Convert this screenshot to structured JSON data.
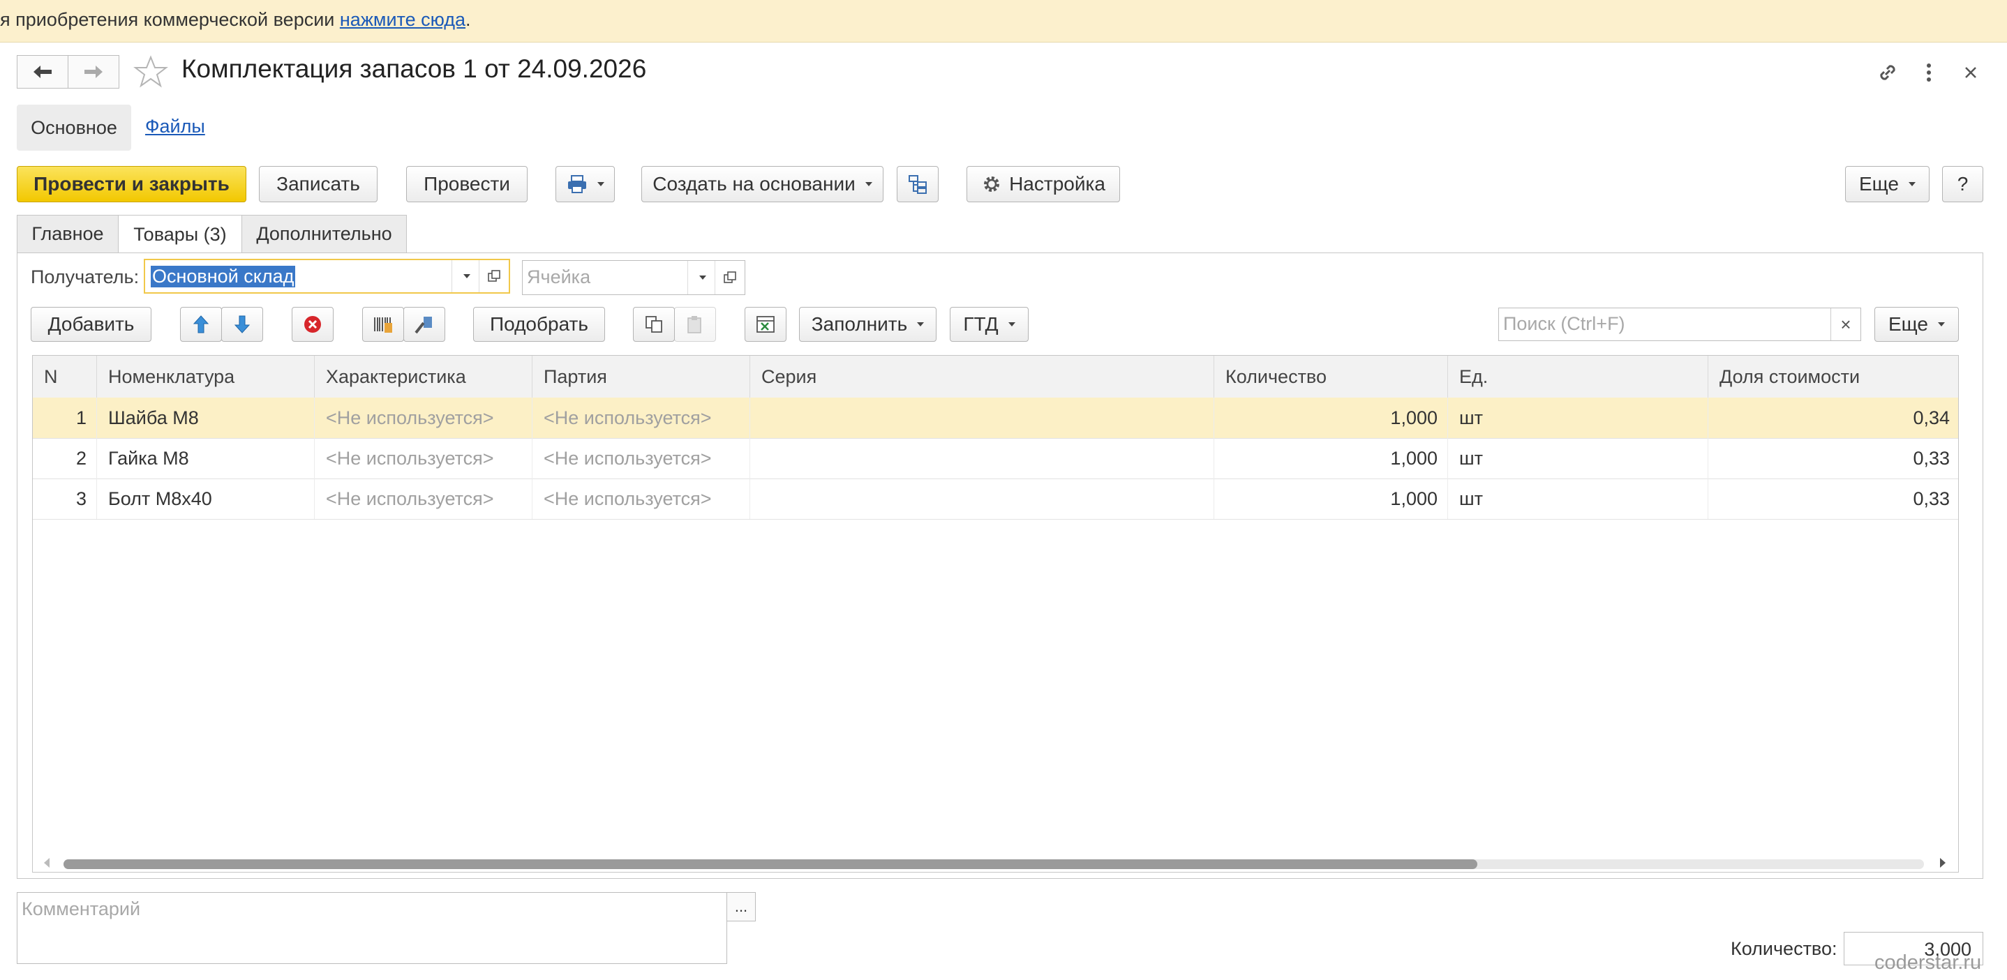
{
  "banner": {
    "text": "я приобретения коммерческой версии ",
    "link": "нажмите сюда",
    "after": "."
  },
  "header": {
    "title": "Комплектация запасов 1 от 24.09.2026"
  },
  "section_tabs": {
    "main": "Основное",
    "files": "Файлы"
  },
  "toolbar": {
    "post_close": "Провести и закрыть",
    "save": "Записать",
    "post": "Провести",
    "create_based": "Создать на основании",
    "settings": "Настройка",
    "more": "Еще",
    "help": "?"
  },
  "tabs": [
    "Главное",
    "Товары (3)",
    "Дополнительно"
  ],
  "recipient": {
    "label": "Получатель:",
    "value": "Основной склад",
    "cell_placeholder": "Ячейка"
  },
  "table_toolbar": {
    "add": "Добавить",
    "pick": "Подобрать",
    "fill": "Заполнить",
    "gtd": "ГТД",
    "search_placeholder": "Поиск (Ctrl+F)",
    "clear": "×",
    "more": "Еще"
  },
  "table": {
    "columns": [
      "N",
      "Номенклатура",
      "Характеристика",
      "Партия",
      "Серия",
      "Количество",
      "Ед.",
      "Доля стоимости"
    ],
    "rows": [
      {
        "n": "1",
        "name": "Шайба М8",
        "char": "<Не используется>",
        "batch": "<Не используется>",
        "series": "",
        "qty": "1,000",
        "unit": "шт",
        "share": "0,34",
        "selected": true
      },
      {
        "n": "2",
        "name": "Гайка М8",
        "char": "<Не используется>",
        "batch": "<Не используется>",
        "series": "",
        "qty": "1,000",
        "unit": "шт",
        "share": "0,33",
        "selected": false
      },
      {
        "n": "3",
        "name": "Болт М8х40",
        "char": "<Не используется>",
        "batch": "<Не используется>",
        "series": "",
        "qty": "1,000",
        "unit": "шт",
        "share": "0,33",
        "selected": false
      }
    ],
    "scroll_position": 0.76
  },
  "footer": {
    "comment_placeholder": "Комментарий",
    "ellipsis": "...",
    "qty_label": "Количество:",
    "qty_total": "3,000"
  },
  "watermark": "coderstar.ru",
  "colors": {
    "primary": "#f4cb06",
    "selected_row": "#fcf0c6",
    "banner": "#fcf0cd",
    "link": "#1a59b8"
  }
}
